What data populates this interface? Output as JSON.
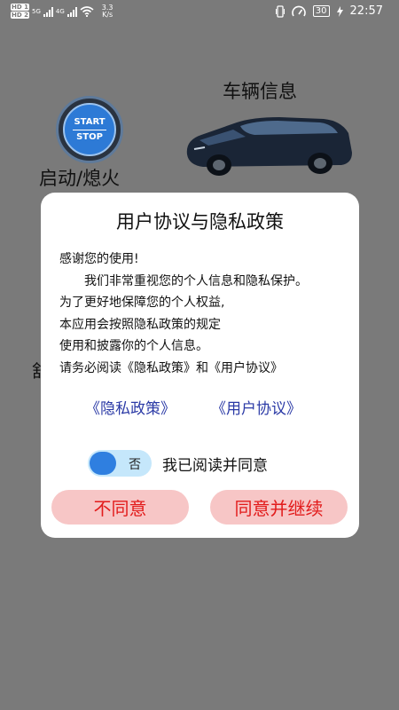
{
  "status_bar": {
    "sim1_tag": "HD 1",
    "sim2_tag": "HD 2",
    "net1": "5G",
    "net2": "4G",
    "speed_value": "3.3",
    "speed_unit": "K/s",
    "battery": "30",
    "time": "22:57"
  },
  "background": {
    "car_info_title": "车辆信息",
    "start_stop_top": "START",
    "start_stop_bottom": "STOP",
    "ignition_label": "启动/熄火",
    "partial_label": "舒"
  },
  "dialog": {
    "title": "用户协议与隐私政策",
    "body_lines": [
      "感谢您的使用!",
      "　　我们非常重视您的个人信息和隐私保护。",
      "为了更好地保障您的个人权益,",
      "本应用会按照隐私政策的规定",
      "使用和披露你的个人信息。",
      "请务必阅读《隐私政策》和《用户协议》"
    ],
    "privacy_link": "《隐私政策》",
    "agreement_link": "《用户协议》",
    "toggle_state_text": "否",
    "agree_label": "我已阅读并同意",
    "disagree_button": "不同意",
    "agree_button": "同意并继续"
  },
  "colors": {
    "overlay": "#7a7a7a",
    "link": "#2b3aa6",
    "button_bg": "#f7c6c6",
    "button_text": "#e21b1b",
    "toggle_knob": "#2f7fe0",
    "toggle_track": "#c5e7fb"
  }
}
